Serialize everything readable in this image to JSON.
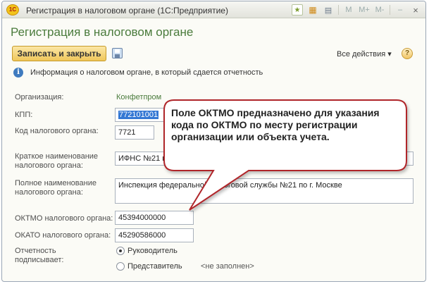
{
  "window": {
    "title": "Регистрация в налоговом органе (1С:Предприятие)",
    "logo_text": "1С",
    "icons": [
      "star-icon",
      "calendar-icon",
      "calculator-icon",
      "m-icon",
      "m-plus-icon",
      "m-minus-icon",
      "minimize-icon",
      "close-icon"
    ],
    "icon_labels": {
      "m": "M",
      "m_plus": "M+",
      "m_minus": "M-",
      "minimize": "–",
      "close": "×"
    }
  },
  "form": {
    "title": "Регистрация в налоговом органе",
    "toolbar": {
      "save_close_label": "Записать и закрыть",
      "all_actions_label": "Все действия ▾",
      "help_label": "?"
    },
    "info_text": "Информация о налоговом органе, в который сдается отчетность",
    "fields": {
      "organization": {
        "label": "Организация:",
        "value": "Конфетпром"
      },
      "kpp": {
        "label": "КПП:",
        "value": "772101001"
      },
      "tax_code": {
        "label": "Код налогового органа:",
        "value": "7721"
      },
      "short_name": {
        "label": "Краткое наименование налогового органа:",
        "value": "ИФНС №21 по г. Москве"
      },
      "full_name": {
        "label": "Полное наименование налогового органа:",
        "value": "Инспекция федеральной налоговой службы №21 по г. Москве"
      },
      "oktmo": {
        "label": "ОКТМО налогового органа:",
        "value": "45394000000"
      },
      "okato": {
        "label": "ОКАТО налогового органа:",
        "value": "45290586000"
      }
    },
    "signer": {
      "label": "Отчетность подписывает:",
      "options": [
        {
          "label": "Руководитель",
          "selected": true
        },
        {
          "label": "Представитель",
          "selected": false
        }
      ],
      "representative_hint": "<не заполнен>"
    }
  },
  "callout": {
    "text": "Поле ОКТМО предназначено для указания кода по ОКТМО по месту регистрации организации или объекта учета."
  },
  "colors": {
    "title_green": "#4a7b3c",
    "save_button": "#f0c75a",
    "callout_border": "#b0252a",
    "selection_blue": "#3478d4"
  }
}
